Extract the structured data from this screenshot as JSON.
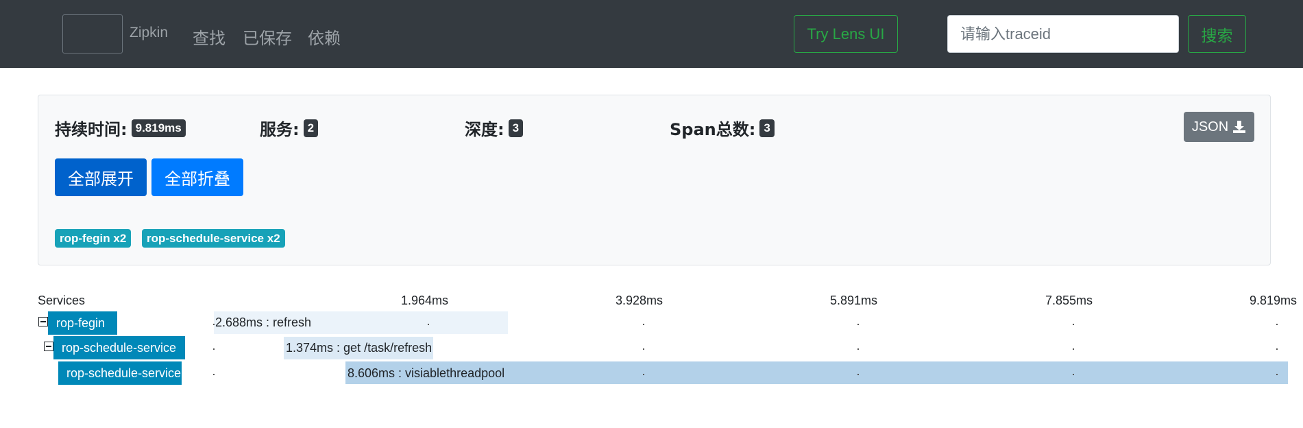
{
  "navbar": {
    "brand": "Zipkin",
    "links": [
      "查找",
      "已保存",
      "依赖"
    ],
    "lens_button": "Try Lens UI",
    "search_placeholder": "请输入traceid",
    "search_button": "搜索"
  },
  "summary": {
    "duration_label": "持续时间:",
    "duration_value": "9.819ms",
    "services_label": "服务:",
    "services_value": "2",
    "depth_label": "深度:",
    "depth_value": "3",
    "spans_label": "Span总数:",
    "spans_value": "3",
    "json_button": "JSON",
    "expand_all": "全部展开",
    "collapse_all": "全部折叠",
    "service_badges": [
      "rop-fegin x2",
      "rop-schedule-service x2"
    ]
  },
  "timeline": {
    "services_header": "Services",
    "ticks": [
      "1.964ms",
      "3.928ms",
      "5.891ms",
      "7.855ms",
      "9.819ms"
    ],
    "spans": [
      {
        "service": "rop-fegin",
        "label": "2.688ms : refresh"
      },
      {
        "service": "rop-schedule-service",
        "label": "1.374ms : get /task/refresh"
      },
      {
        "service": "rop-schedule-service",
        "label": "8.606ms : visiablethreadpool"
      }
    ]
  },
  "colors": {
    "navbar_bg": "#343a40",
    "success": "#28a745",
    "primary": "#007bff",
    "info_badge": "#17a2b8",
    "service_label_bg": "#0088b8"
  }
}
